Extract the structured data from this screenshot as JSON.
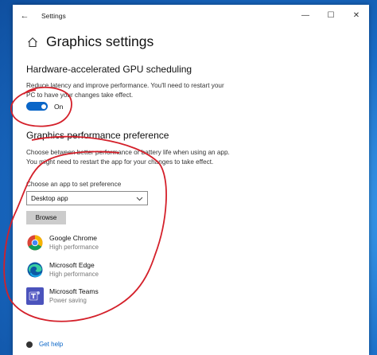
{
  "window": {
    "title": "Settings",
    "back_glyph": "←",
    "minimize_glyph": "—",
    "maximize_glyph": "☐",
    "close_glyph": "✕"
  },
  "page": {
    "title": "Graphics settings",
    "home_icon": "home-icon"
  },
  "gpu_scheduling": {
    "title": "Hardware-accelerated GPU scheduling",
    "description_line1": "Reduce latency and improve performance. You'll need to restart your",
    "description_line2": "PC to have your changes take effect.",
    "toggle_state": "On",
    "toggle_on": true
  },
  "graphics_pref": {
    "title": "Graphics performance preference",
    "description_line1": "Choose between better performance or battery life when using an app.",
    "description_line2": "You might need to restart the app for your changes to take effect.",
    "select_label": "Choose an app to set preference",
    "select_value": "Desktop app",
    "browse_label": "Browse",
    "apps": [
      {
        "name": "Google Chrome",
        "preference": "High performance",
        "icon": "chrome-icon"
      },
      {
        "name": "Microsoft Edge",
        "preference": "High performance",
        "icon": "edge-icon"
      },
      {
        "name": "Microsoft Teams",
        "preference": "Power saving",
        "icon": "teams-icon"
      }
    ]
  },
  "help": {
    "label": "Get help"
  },
  "colors": {
    "accent": "#0a66c8",
    "annotation": "#d4202a",
    "desktop": "#1b6fc4"
  }
}
